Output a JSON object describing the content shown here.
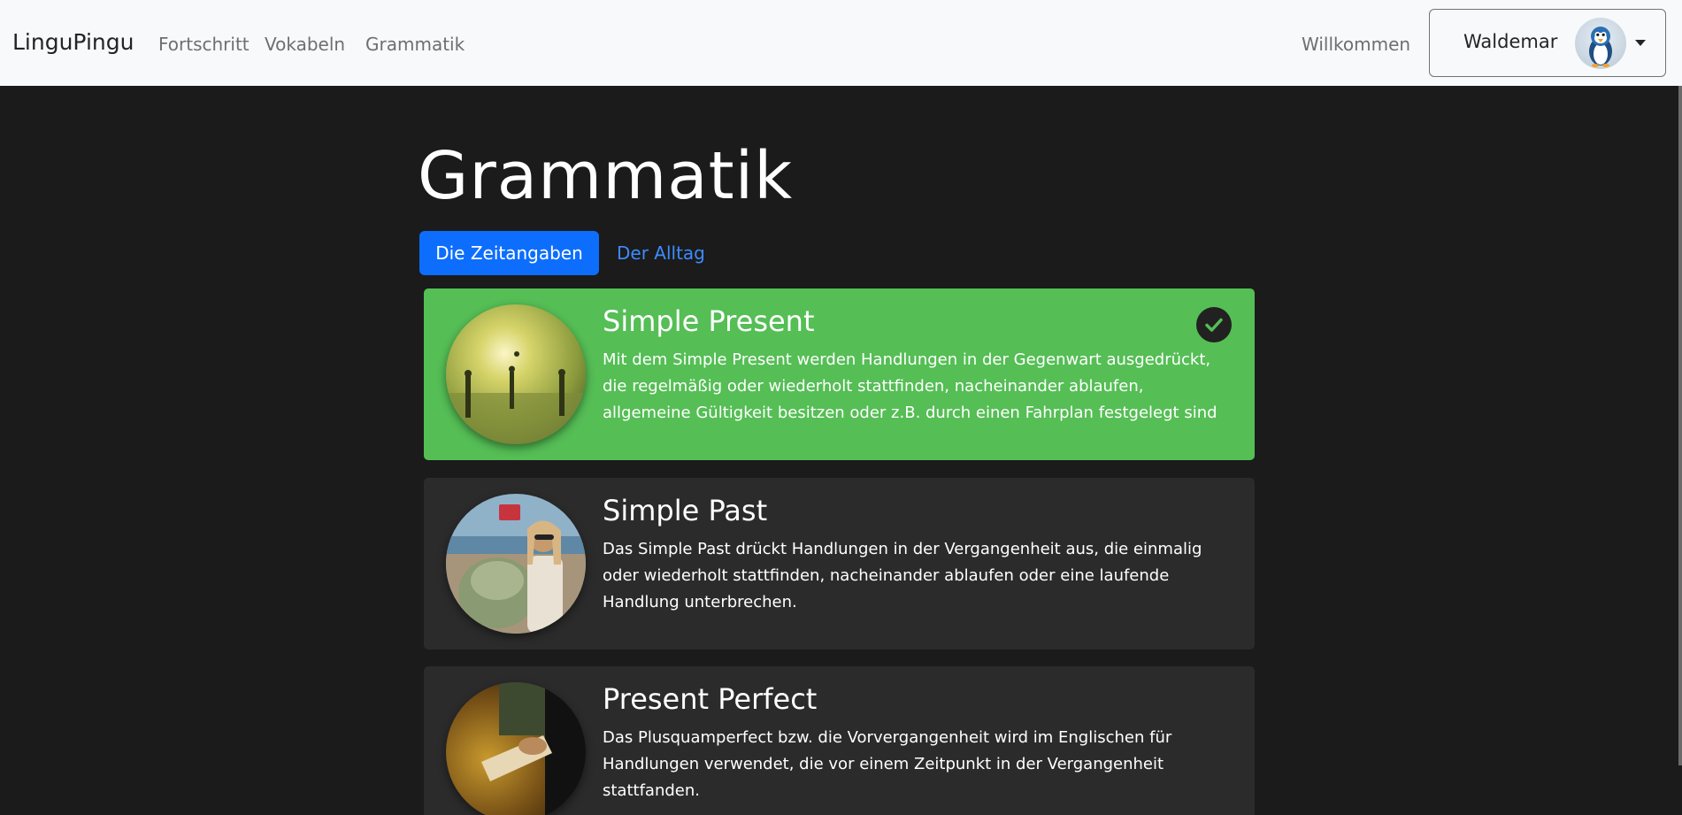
{
  "navbar": {
    "brand": "LinguPingu",
    "links": [
      "Fortschritt",
      "Vokabeln",
      "Grammatik"
    ],
    "welcome": "Willkommen",
    "user_name": "Waldemar"
  },
  "page": {
    "title": "Grammatik",
    "tabs": [
      "Die Zeitangaben",
      "Der Alltag"
    ],
    "active_tab": "Die Zeitangaben"
  },
  "colors": {
    "primary": "#0d6efd",
    "completed_card": "#55be55",
    "card": "#2b2b2b",
    "background": "#1b1b1b"
  },
  "lessons": [
    {
      "title": "Simple Present",
      "text": "Mit dem Simple Present werden Handlungen in der Gegenwart ausgedrückt, die regelmäßig oder wiederholt stattfinden, nacheinander ablaufen, allgemeine Gültigkeit besitzen oder z.B. durch einen Fahrplan festgelegt sind",
      "completed": true,
      "icon": "check-icon"
    },
    {
      "title": "Simple Past",
      "text": "Das Simple Past drückt Handlungen in der Vergangenheit aus, die einmalig oder wiederholt stattfinden, nacheinander ablaufen oder eine laufende Handlung unterbrechen.",
      "completed": false
    },
    {
      "title": "Present Perfect",
      "text": "Das Plusquamperfect bzw. die Vorvergangenheit wird im Englischen für Handlungen verwendet, die vor einem Zeitpunkt in der Vergangenheit stattfanden.",
      "completed": false
    }
  ]
}
